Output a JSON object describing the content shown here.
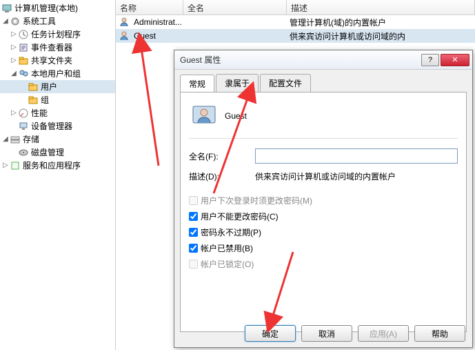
{
  "tree": {
    "root": "计算机管理(本地)",
    "items": [
      {
        "label": "系统工具",
        "icon": "gear"
      },
      {
        "label": "任务计划程序",
        "icon": "task"
      },
      {
        "label": "事件查看器",
        "icon": "event"
      },
      {
        "label": "共享文件夹",
        "icon": "share"
      },
      {
        "label": "本地用户和组",
        "icon": "users"
      },
      {
        "label": "用户",
        "icon": "folder"
      },
      {
        "label": "组",
        "icon": "folder"
      },
      {
        "label": "性能",
        "icon": "perf"
      },
      {
        "label": "设备管理器",
        "icon": "device"
      },
      {
        "label": "存储",
        "icon": "storage"
      },
      {
        "label": "磁盘管理",
        "icon": "disk"
      },
      {
        "label": "服务和应用程序",
        "icon": "services"
      }
    ]
  },
  "list": {
    "headers": {
      "name": "名称",
      "fullname": "全名",
      "desc": "描述"
    },
    "rows": [
      {
        "name": "Administrat...",
        "desc": "管理计算机(域)的内置帐户"
      },
      {
        "name": "Guest",
        "desc": "供来宾访问计算机或访问域的内"
      }
    ]
  },
  "dialog": {
    "title": "Guest 属性",
    "tabs": {
      "general": "常规",
      "memberof": "隶属于",
      "profile": "配置文件"
    },
    "username": "Guest",
    "fields": {
      "fullname_label": "全名(F):",
      "fullname_value": "",
      "desc_label": "描述(D):",
      "desc_value": "供来宾访问计算机或访问域的内置帐户"
    },
    "checks": {
      "mustchange": "用户下次登录时须更改密码(M)",
      "cannotchange": "用户不能更改密码(C)",
      "neverexpire": "密码永不过期(P)",
      "disabled": "帐户已禁用(B)",
      "locked": "帐户已锁定(O)"
    },
    "buttons": {
      "ok": "确定",
      "cancel": "取消",
      "apply": "应用(A)",
      "help": "帮助"
    }
  }
}
